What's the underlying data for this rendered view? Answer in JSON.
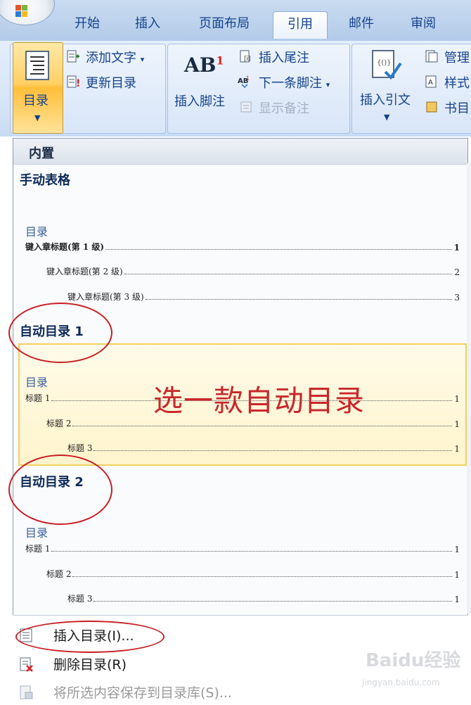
{
  "tabs": [
    "开始",
    "插入",
    "页面布局",
    "引用",
    "邮件",
    "审阅"
  ],
  "active_tab": "引用",
  "ribbon": {
    "toc_button": "目录",
    "add_text": "添加文字",
    "update_toc": "更新目录",
    "insert_footnote": "插入脚注",
    "insert_endnote": "插入尾注",
    "next_footnote": "下一条脚注",
    "show_notes": "显示备注",
    "insert_citation": "插入引文",
    "manage": "管理",
    "style": "样式",
    "bibliography": "书目",
    "ab_glyph": "AB",
    "footnote_sup": "1"
  },
  "panel": {
    "header": "内置",
    "sections": [
      {
        "title": "手动表格",
        "toc_title": "目录",
        "rows": [
          {
            "label": "键入章标题(第 1 级)",
            "page": "1"
          },
          {
            "label": "键入章标题(第 2 级)",
            "page": "2"
          },
          {
            "label": "键入章标题(第 3 级)",
            "page": "3"
          }
        ]
      },
      {
        "title": "自动目录 1",
        "toc_title": "目录",
        "rows": [
          {
            "label": "标题 1",
            "page": "1"
          },
          {
            "label": "标题 2",
            "page": "1"
          },
          {
            "label": "标题 3",
            "page": "1"
          }
        ]
      },
      {
        "title": "自动目录 2",
        "toc_title": "目录",
        "rows": [
          {
            "label": "标题 1",
            "page": "1"
          },
          {
            "label": "标题 2",
            "page": "1"
          },
          {
            "label": "标题 3",
            "page": "1"
          }
        ]
      }
    ],
    "annotation": "选一款自动目录"
  },
  "menu": {
    "insert_toc": "插入目录(I)...",
    "delete_toc": "删除目录(R)",
    "save_selection": "将所选内容保存到目录库(S)..."
  },
  "watermark": {
    "logo": "Baidu经验",
    "url": "jingyan.baidu.com"
  },
  "colors": {
    "ribbon_text": "#15428b",
    "highlight": "#ffd065",
    "annotation_red": "#c8282c"
  }
}
